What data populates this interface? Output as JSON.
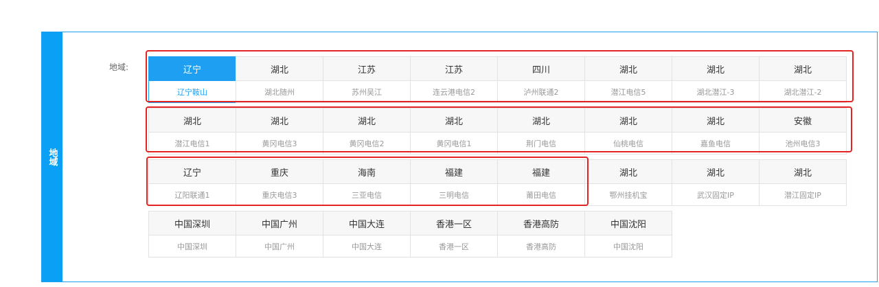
{
  "side_tab": "地域",
  "region_label": "地域:",
  "rows": [
    [
      {
        "province": "辽宁",
        "line": "辽宁鞍山",
        "selected": true
      },
      {
        "province": "湖北",
        "line": "湖北随州"
      },
      {
        "province": "江苏",
        "line": "苏州吴江"
      },
      {
        "province": "江苏",
        "line": "连云港电信2"
      },
      {
        "province": "四川",
        "line": "泸州联通2"
      },
      {
        "province": "湖北",
        "line": "潜江电信5"
      },
      {
        "province": "湖北",
        "line": "湖北潜江-3"
      },
      {
        "province": "湖北",
        "line": "湖北潜江-2"
      }
    ],
    [
      {
        "province": "湖北",
        "line": "潜江电信1"
      },
      {
        "province": "湖北",
        "line": "黄冈电信3"
      },
      {
        "province": "湖北",
        "line": "黄冈电信2"
      },
      {
        "province": "湖北",
        "line": "黄冈电信1"
      },
      {
        "province": "湖北",
        "line": "荆门电信"
      },
      {
        "province": "湖北",
        "line": "仙桃电信"
      },
      {
        "province": "湖北",
        "line": "嘉鱼电信"
      },
      {
        "province": "安徽",
        "line": "池州电信3"
      }
    ],
    [
      {
        "province": "辽宁",
        "line": "辽阳联通1"
      },
      {
        "province": "重庆",
        "line": "重庆电信3"
      },
      {
        "province": "海南",
        "line": "三亚电信"
      },
      {
        "province": "福建",
        "line": "三明电信"
      },
      {
        "province": "福建",
        "line": "莆田电信"
      },
      {
        "province": "湖北",
        "line": "鄂州挂机宝"
      },
      {
        "province": "湖北",
        "line": "武汉固定IP"
      },
      {
        "province": "湖北",
        "line": "潜江固定IP"
      }
    ],
    [
      {
        "province": "中国深圳",
        "line": "中国深圳"
      },
      {
        "province": "中国广州",
        "line": "中国广州"
      },
      {
        "province": "中国大连",
        "line": "中国大连"
      },
      {
        "province": "香港一区",
        "line": "香港一区"
      },
      {
        "province": "香港高防",
        "line": "香港高防"
      },
      {
        "province": "中国沈阳",
        "line": "中国沈阳"
      }
    ]
  ],
  "colors": {
    "accent": "#1e9ff2",
    "highlight": "#e52222"
  }
}
